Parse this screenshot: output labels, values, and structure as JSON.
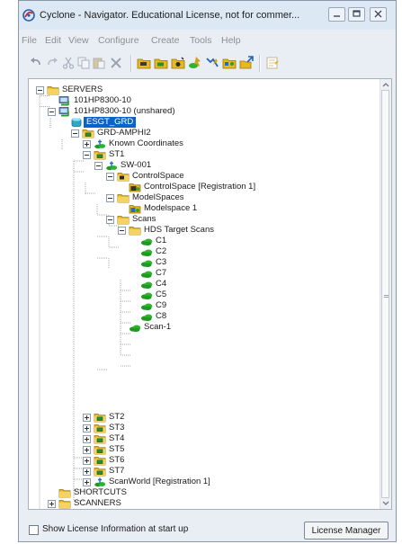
{
  "window": {
    "title": "Cyclone - Navigator. Educational License, not for commer...",
    "controls": [
      "minimize-icon",
      "maximize-icon",
      "close-icon"
    ]
  },
  "menu": {
    "items": [
      "File",
      "Edit",
      "View",
      "Configure",
      "Create",
      "Tools",
      "Help"
    ]
  },
  "toolbar": {
    "icons": [
      "undo-icon",
      "redo-icon",
      "cut-icon",
      "copy-icon",
      "paste-icon",
      "delete-icon",
      "open-folder-icon",
      "new-folder-icon",
      "scan-folder-icon",
      "registration-icon",
      "modelspace-icon",
      "unify-icon",
      "export-icon",
      "properties-icon"
    ]
  },
  "tree": {
    "selected": "ESGT_GRD",
    "nodes": [
      {
        "label": "SERVERS",
        "icon": "servers-icon"
      },
      {
        "label": "101HP8300-10",
        "icon": "server-icon"
      },
      {
        "label": "101HP8300-10 (unshared)",
        "icon": "server-icon"
      },
      {
        "label": "ESGT_GRD",
        "icon": "database-icon"
      },
      {
        "label": "GRD-AMPHI2",
        "icon": "project-folder-icon"
      },
      {
        "label": "Known Coordinates",
        "icon": "coordinates-icon"
      },
      {
        "label": "ST1",
        "icon": "project-folder-icon"
      },
      {
        "label": "SW-001",
        "icon": "scanworld-icon"
      },
      {
        "label": "ControlSpace",
        "icon": "controlspace-folder-icon"
      },
      {
        "label": "ControlSpace [Registration 1]",
        "icon": "controlspace-icon"
      },
      {
        "label": "ModelSpaces",
        "icon": "folder-icon"
      },
      {
        "label": "Modelspace 1",
        "icon": "modelspace-icon"
      },
      {
        "label": "Scans",
        "icon": "folder-icon"
      },
      {
        "label": "HDS Target Scans",
        "icon": "folder-icon"
      },
      {
        "label": "C1",
        "icon": "target-scan-icon"
      },
      {
        "label": "C2",
        "icon": "target-scan-icon"
      },
      {
        "label": "C3",
        "icon": "target-scan-icon"
      },
      {
        "label": "C7",
        "icon": "target-scan-icon"
      },
      {
        "label": "C4",
        "icon": "target-scan-icon"
      },
      {
        "label": "C5",
        "icon": "target-scan-icon"
      },
      {
        "label": "C9",
        "icon": "target-scan-icon"
      },
      {
        "label": "C8",
        "icon": "target-scan-icon"
      },
      {
        "label": "Scan-1",
        "icon": "scan-icon"
      },
      {
        "label": "ST2",
        "icon": "project-folder-icon"
      },
      {
        "label": "ST3",
        "icon": "project-folder-icon"
      },
      {
        "label": "ST4",
        "icon": "project-folder-icon"
      },
      {
        "label": "ST5",
        "icon": "project-folder-icon"
      },
      {
        "label": "ST6",
        "icon": "project-folder-icon"
      },
      {
        "label": "ST7",
        "icon": "project-folder-icon"
      },
      {
        "label": "ScanWorld [Registration 1]",
        "icon": "scanworld-icon"
      },
      {
        "label": "SHORTCUTS",
        "icon": "shortcuts-icon"
      },
      {
        "label": "SCANNERS",
        "icon": "scanners-icon"
      }
    ]
  },
  "footer": {
    "checkbox_label": "Show License Information at start up",
    "checkbox_checked": false,
    "license_button": "License Manager"
  },
  "colors": {
    "selection": "#0a64c8",
    "folder": "#e8b820",
    "scan_cloud": "#1f9a1f"
  }
}
